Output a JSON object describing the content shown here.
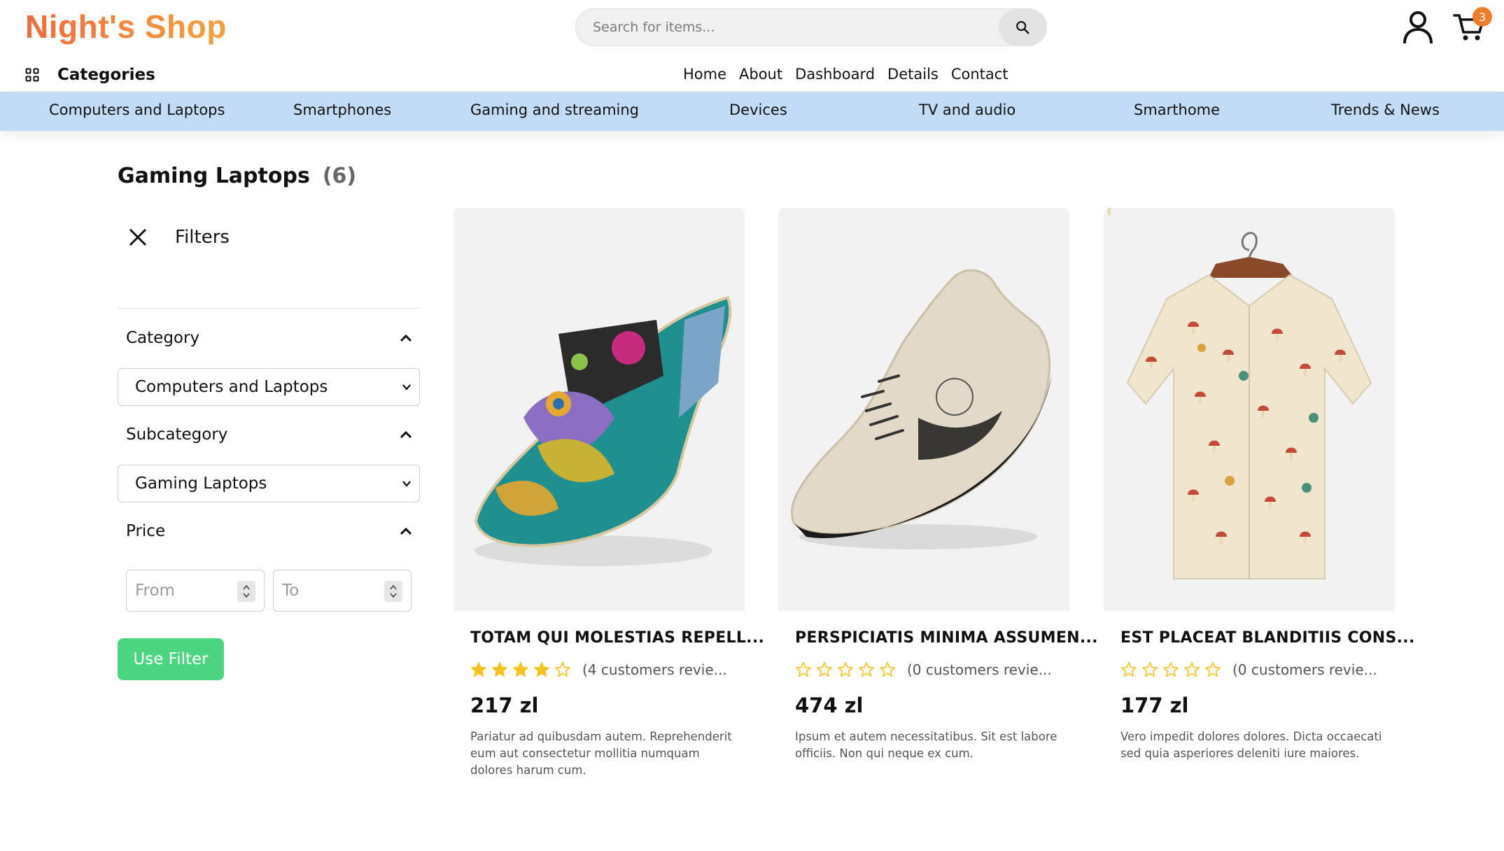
{
  "header": {
    "logo": "Night's Shop",
    "search": {
      "placeholder": "Search for items..."
    },
    "cart_count": "3",
    "categories_label": "Categories",
    "nav": [
      "Home",
      "About",
      "Dashboard",
      "Details",
      "Contact"
    ]
  },
  "category_bar": [
    "Computers and Laptops",
    "Smartphones",
    "Gaming and streaming",
    "Devices",
    "TV and audio",
    "Smarthome",
    "Trends & News"
  ],
  "listing": {
    "title": "Gaming Laptops",
    "count": "(6)"
  },
  "filters": {
    "title": "Filters",
    "category": {
      "label": "Category",
      "value": "Computers and Laptops"
    },
    "subcategory": {
      "label": "Subcategory",
      "value": "Gaming Laptops"
    },
    "price": {
      "label": "Price",
      "from_placeholder": "From",
      "to_placeholder": "To"
    },
    "apply_label": "Use Filter"
  },
  "products": [
    {
      "name": "TOTAM QUI MOLESTIAS REPELL...",
      "rating": 4,
      "reviews": "(4 customers revie...",
      "price": "217 zl",
      "description": "Pariatur ad quibusdam autem. Reprehenderit eum aut consectetur mollitia numquam dolores harum cum.",
      "image": "colorful-sandal"
    },
    {
      "name": "PERSPICIATIS MINIMA ASSUMEN...",
      "rating": 0,
      "reviews": "(0 customers revie...",
      "price": "474 zl",
      "description": "Ipsum et autem necessitatibus. Sit est labore officiis. Non qui neque ex cum.",
      "image": "beige-sneaker"
    },
    {
      "name": "EST PLACEAT BLANDITIIS CONS...",
      "rating": 0,
      "reviews": "(0 customers revie...",
      "price": "177 zl",
      "description": "Vero impedit dolores dolores. Dicta occaecati sed quia asperiores deleniti iure maiores.",
      "image": "mushroom-print-shirt"
    }
  ],
  "colors": {
    "logo_gradient": [
      "#f26a3d",
      "#f2a43d"
    ],
    "category_bar": "#c2dcf6",
    "badge": "#f07b2b",
    "star": "#f6c21c",
    "filter_button": "#4cd580"
  }
}
